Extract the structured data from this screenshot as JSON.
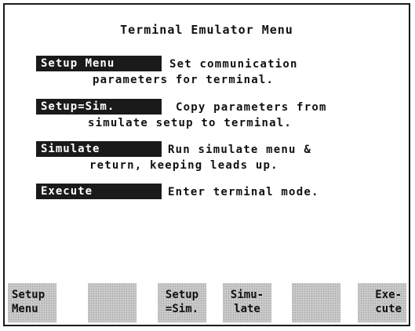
{
  "title": "Terminal Emulator Menu",
  "menu_items": [
    {
      "button": "Setup Menu",
      "line1": "Set communication",
      "line2": "parameters for terminal."
    },
    {
      "button": "Setup=Sim.",
      "line1": "Copy parameters from",
      "line2": "simulate setup to terminal."
    },
    {
      "button": "Simulate",
      "line1": "Run simulate menu &",
      "line2": "return, keeping leads up."
    },
    {
      "button": "Execute",
      "line1": "Enter terminal mode.",
      "line2": ""
    }
  ],
  "softkeys": [
    {
      "line1": "Setup",
      "line2": "Menu"
    },
    {
      "line1": "",
      "line2": ""
    },
    {
      "line1": "Setup",
      "line2": "=Sim."
    },
    {
      "line1": "Simu-",
      "line2": "late"
    },
    {
      "line1": "",
      "line2": ""
    },
    {
      "line1": "Exe-",
      "line2": "cute"
    }
  ]
}
